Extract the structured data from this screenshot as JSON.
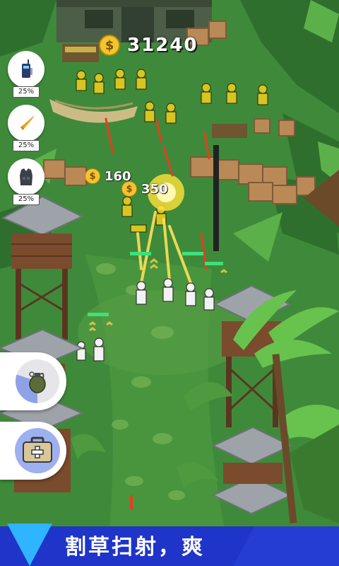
{
  "hud": {
    "coin_icon": "dollar-coin-icon",
    "coins": "31240"
  },
  "rewards": [
    {
      "amount": "160"
    },
    {
      "amount": "350"
    }
  ],
  "upgrades": [
    {
      "icon": "radio-icon",
      "level": "25%"
    },
    {
      "icon": "bullet-icon",
      "level": "25%"
    },
    {
      "icon": "armor-vest-icon",
      "level": "25%"
    }
  ],
  "skills": [
    {
      "icon": "grenade-icon",
      "cooldown_fraction": 0.3
    },
    {
      "icon": "medkit-icon"
    }
  ],
  "banner": {
    "text": "割草扫射，爽",
    "colors": {
      "band": "#1f34c9",
      "triangle": "#2fb4ff"
    }
  },
  "colors": {
    "grass": "#3f8a3a",
    "enemy": "#d7c521",
    "player": "#f2f2f2",
    "crate": "#b98957",
    "tower": "#7a4b2c",
    "roof": "#9da3a8"
  }
}
